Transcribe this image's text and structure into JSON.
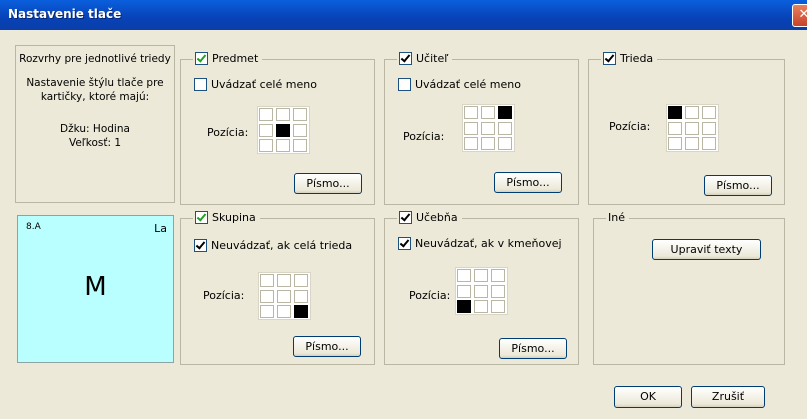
{
  "window": {
    "title": "Nastavenie tlače",
    "close_glyph": "✕"
  },
  "info": {
    "line1": "Rozvrhy pre jednotlivé triedy",
    "line2": "Nastavenie štýlu tlače pre",
    "line3": "kartičky, ktoré majú:",
    "line4": "Džku: Hodina",
    "line5": "Veľkosť: 1"
  },
  "preview": {
    "top_left": "8.A",
    "top_right": "La",
    "center": "M",
    "background": "#b9ffff"
  },
  "groups": {
    "predmet": {
      "label": "Predmet",
      "checked": true,
      "option": "Uvádzať celé meno",
      "option_checked": false,
      "position_label": "Pozícia:",
      "button": "Písmo...",
      "selected_cell": "middle-center"
    },
    "ucitel": {
      "label": "Učiteľ",
      "checked": true,
      "option": "Uvádzať celé meno",
      "option_checked": false,
      "position_label": "Pozícia:",
      "button": "Písmo...",
      "selected_cell": "top-right"
    },
    "trieda": {
      "label": "Trieda",
      "checked": true,
      "position_label": "Pozícia:",
      "button": "Písmo...",
      "selected_cell": "top-left"
    },
    "skupina": {
      "label": "Skupina",
      "checked": true,
      "option": "Neuvádzať, ak celá trieda",
      "option_checked": true,
      "position_label": "Pozícia:",
      "button": "Písmo...",
      "selected_cell": "bottom-right"
    },
    "ucebna": {
      "label": "Učebňa",
      "checked": true,
      "option": "Neuvádzať, ak v kmeňovej",
      "option_checked": true,
      "position_label": "Pozícia:",
      "button": "Písmo...",
      "selected_cell": "bottom-left"
    },
    "ine": {
      "label": "Iné",
      "button": "Upraviť texty"
    }
  },
  "footer": {
    "ok": "OK",
    "cancel": "Zrušiť"
  }
}
